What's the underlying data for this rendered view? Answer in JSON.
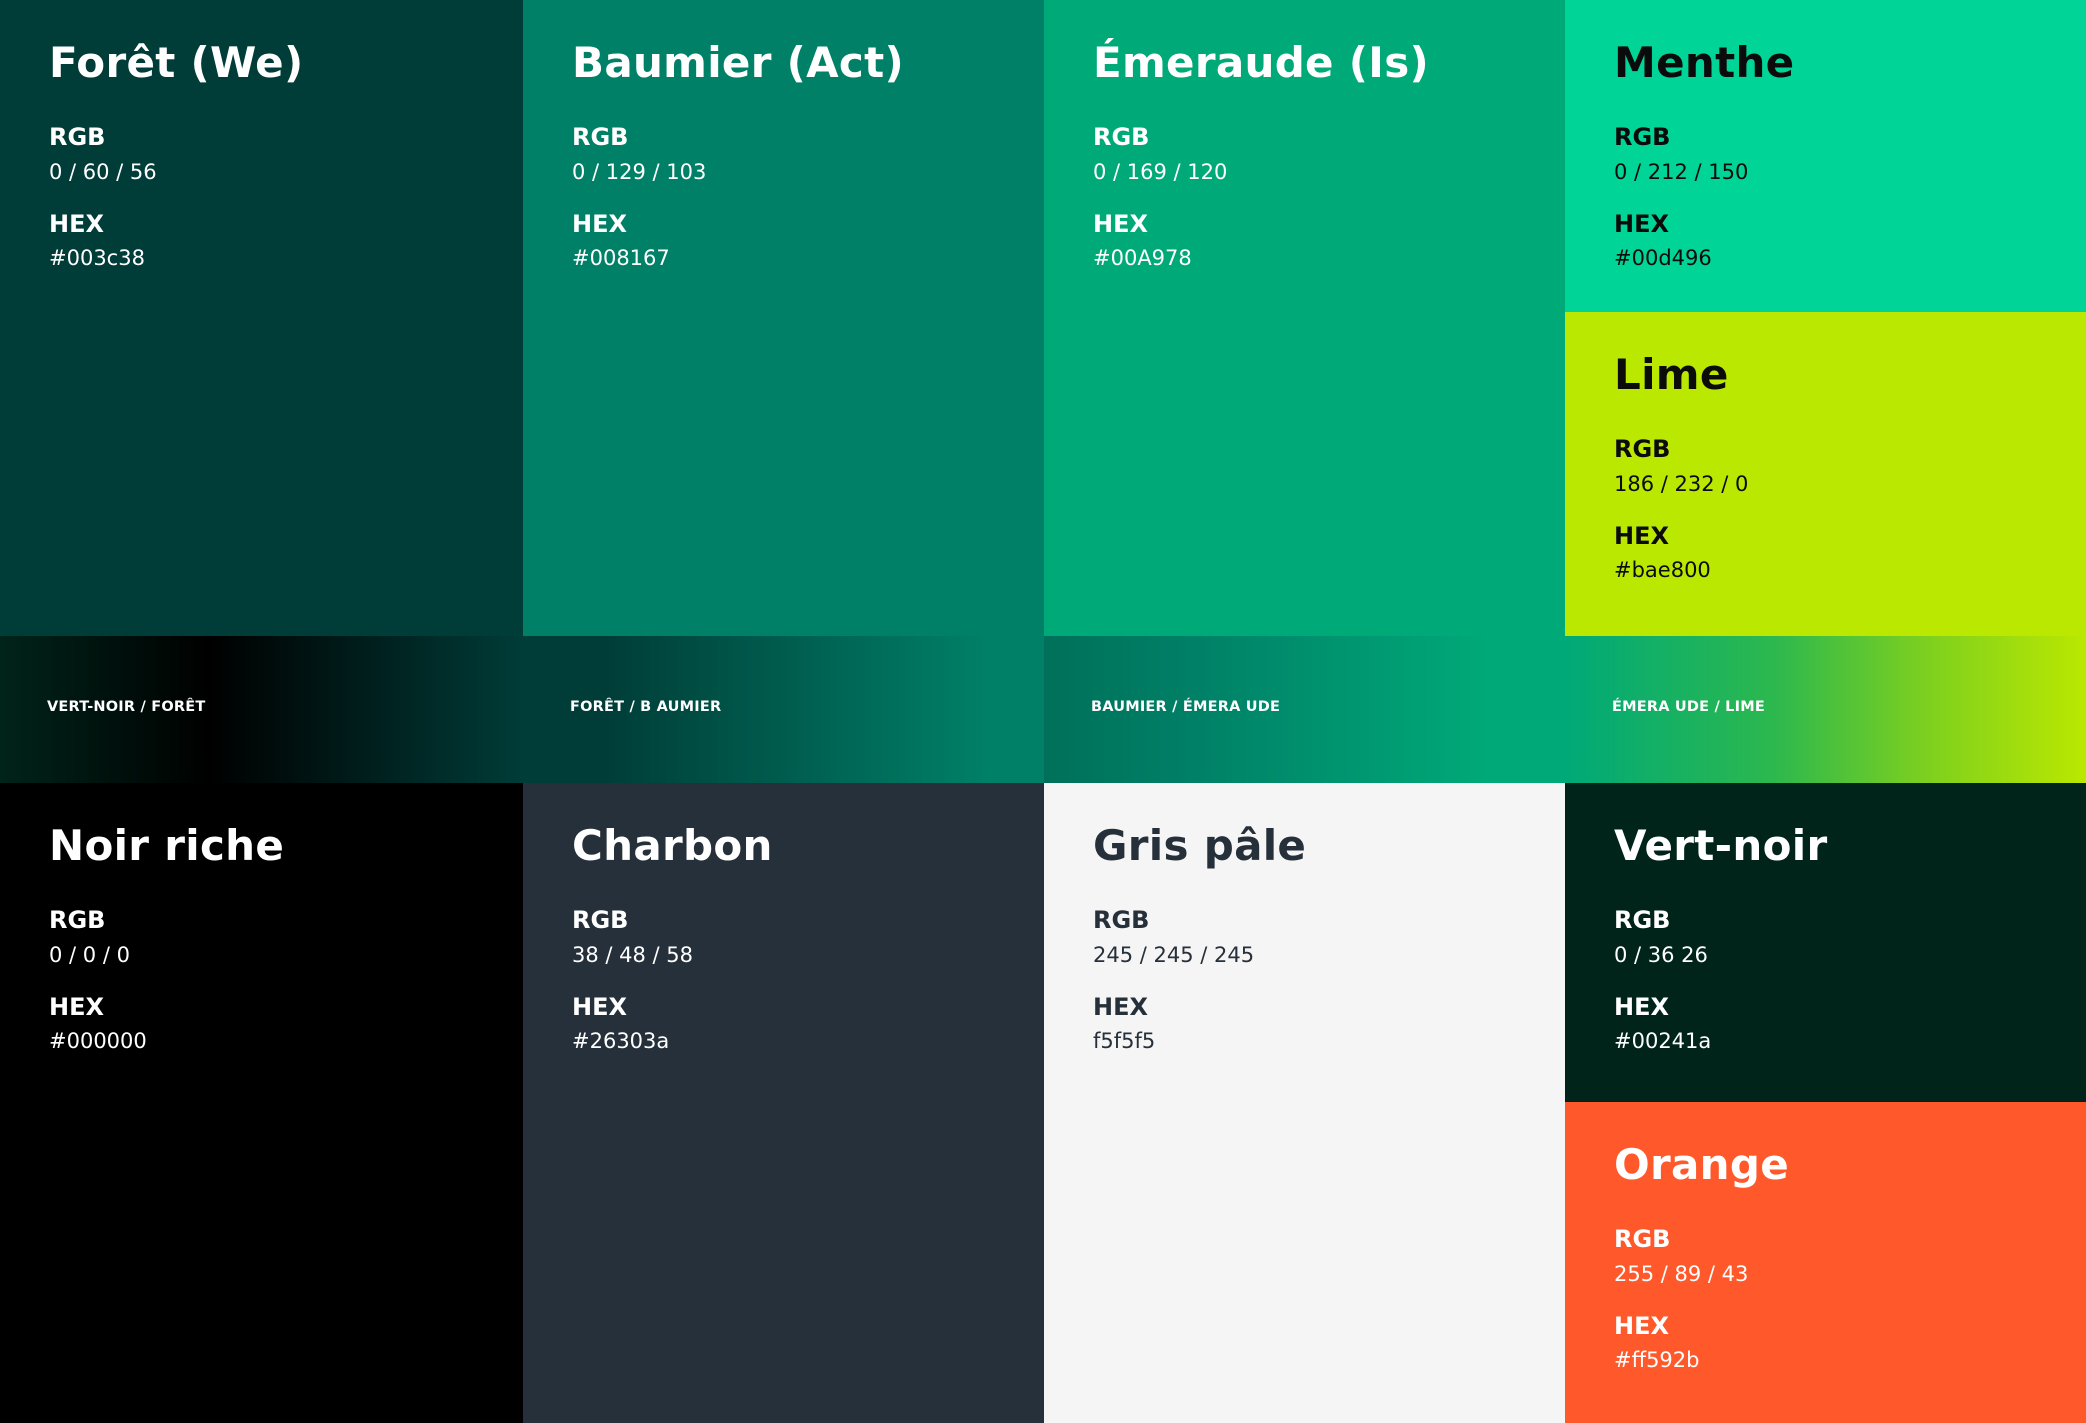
{
  "labels": {
    "rgb": "RGB",
    "hex": "HEX"
  },
  "swatches": [
    {
      "name": "Forêt (We)",
      "rgb": "0 / 60 / 56",
      "hex": "#003c38",
      "color": "#003c38"
    },
    {
      "name": "Baumier (Act)",
      "rgb": "0 / 129 / 103",
      "hex": "#008167",
      "color": "#008167"
    },
    {
      "name": "Émeraude (Is)",
      "rgb": "0 / 169 / 120",
      "hex": "#00A978",
      "color": "#00a978"
    },
    {
      "name": "Menthe",
      "rgb": "0 / 212 / 150",
      "hex": "#00d496",
      "color": "#00d496"
    },
    {
      "name": "Lime",
      "rgb": "186 / 232 / 0",
      "hex": "#bae800",
      "color": "#bae800"
    },
    {
      "name": "Noir riche",
      "rgb": "0 / 0 / 0",
      "hex": "#000000",
      "color": "#000000"
    },
    {
      "name": "Charbon",
      "rgb": "38 / 48 / 58",
      "hex": "#26303a",
      "color": "#26303a"
    },
    {
      "name": "Gris pâle",
      "rgb": "245 / 245 / 245",
      "hex": "f5f5f5",
      "color": "#f5f5f5"
    },
    {
      "name": "Vert-noir",
      "rgb": "0 / 36 26",
      "hex": "#00241a",
      "color": "#00241a"
    },
    {
      "name": "Orange",
      "rgb": "255 / 89 / 43",
      "hex": "#ff592b",
      "color": "#ff592b"
    }
  ],
  "gradients": [
    {
      "label": "VERT-NOIR / FORÊT"
    },
    {
      "label": "FORÊT / B AUMIER"
    },
    {
      "label": "BAUMIER / ÉMERA UDE"
    },
    {
      "label": "ÉMERA UDE / LIME"
    }
  ]
}
